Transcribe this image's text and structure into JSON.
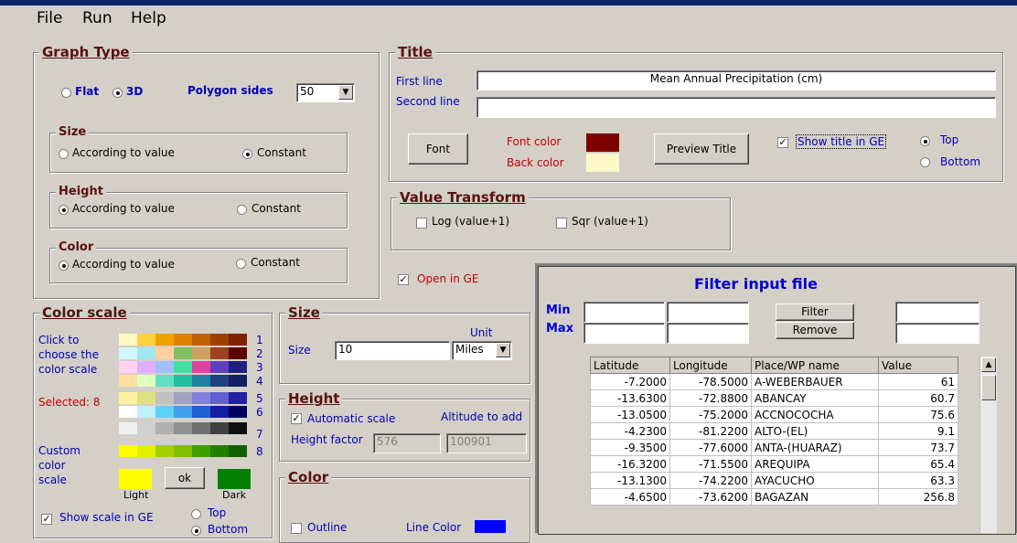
{
  "menu": [
    "File",
    "Run",
    "Help"
  ],
  "graph_type": {
    "legend": "Graph Type",
    "flat": "Flat",
    "three_d": "3D",
    "selected": "3D",
    "polygon_label": "Polygon sides",
    "polygon_value": "50",
    "size": {
      "legend": "Size",
      "opt_value": "According to value",
      "opt_constant": "Constant",
      "selected": "Constant"
    },
    "height": {
      "legend": "Height",
      "opt_value": "According to value",
      "opt_constant": "Constant",
      "selected": "According to value"
    },
    "color": {
      "legend": "Color",
      "opt_value": "According to value",
      "opt_constant": "Constant",
      "selected": "According to value"
    }
  },
  "title_group": {
    "legend": "Title",
    "first_label": "First line",
    "first_value": "Mean Annual Precipitation (cm)",
    "second_label": "Second line",
    "second_value": "",
    "font_button": "Font",
    "font_color_label": "Font color",
    "back_color_label": "Back color",
    "font_color": "#800000",
    "back_color": "#fff8c8",
    "preview_button": "Preview Title",
    "show_title": "Show title in GE",
    "show_title_checked": true,
    "top": "Top",
    "bottom": "Bottom",
    "position": "Top"
  },
  "value_transform": {
    "legend": "Value Transform",
    "log": "Log (value+1)",
    "sqr": "Sqr (value+1)"
  },
  "open_in_ge": "Open in GE",
  "color_scale": {
    "legend": "Color scale",
    "click_text": [
      "Click to",
      "choose the",
      "color scale"
    ],
    "selected": "Selected: 8",
    "numbers": [
      "1",
      "2",
      "3",
      "4",
      "5",
      "6",
      "7",
      "8"
    ],
    "custom": [
      "Custom",
      "color",
      "scale"
    ],
    "ok": "ok",
    "light": "Light",
    "dark": "Dark",
    "show_scale": "Show scale in GE",
    "top": "Top",
    "bottom": "Bottom"
  },
  "size_panel": {
    "legend": "Size",
    "unit_label": "Unit",
    "size_label": "Size",
    "size_value": "10",
    "unit_value": "Miles"
  },
  "height_panel": {
    "legend": "Height",
    "auto_scale": "Automatic scale",
    "alt_label": "Altitude to add",
    "factor_label": "Height factor",
    "factor_value": "576",
    "alt_value": "100901"
  },
  "color_panel": {
    "legend": "Color",
    "outline": "Outline",
    "line_color": "Line Color",
    "line_color_value": "#0000ff"
  },
  "filter": {
    "title": "Filter input file",
    "min": "Min",
    "max": "Max",
    "filter_button": "Filter",
    "remove_button": "Remove",
    "columns": [
      "Latitude",
      "Longitude",
      "Place/WP name",
      "Value"
    ],
    "rows": [
      [
        "-7.2000",
        "-78.5000",
        "A-WEBERBAUER",
        "61"
      ],
      [
        "-13.6300",
        "-72.8800",
        "ABANCAY",
        "60.7"
      ],
      [
        "-13.0500",
        "-75.2000",
        "ACCNOCOCHA",
        "75.6"
      ],
      [
        "-4.2300",
        "-81.2200",
        "ALTO-(EL)",
        "9.1"
      ],
      [
        "-9.3500",
        "-77.6000",
        "ANTA-(HUARAZ)",
        "73.7"
      ],
      [
        "-16.3200",
        "-71.5500",
        "AREQUIPA",
        "65.4"
      ],
      [
        "-13.1300",
        "-74.2200",
        "AYACUCHO",
        "63.3"
      ],
      [
        "-4.6500",
        "-73.6200",
        "BAGAZAN",
        "256.8"
      ]
    ]
  }
}
